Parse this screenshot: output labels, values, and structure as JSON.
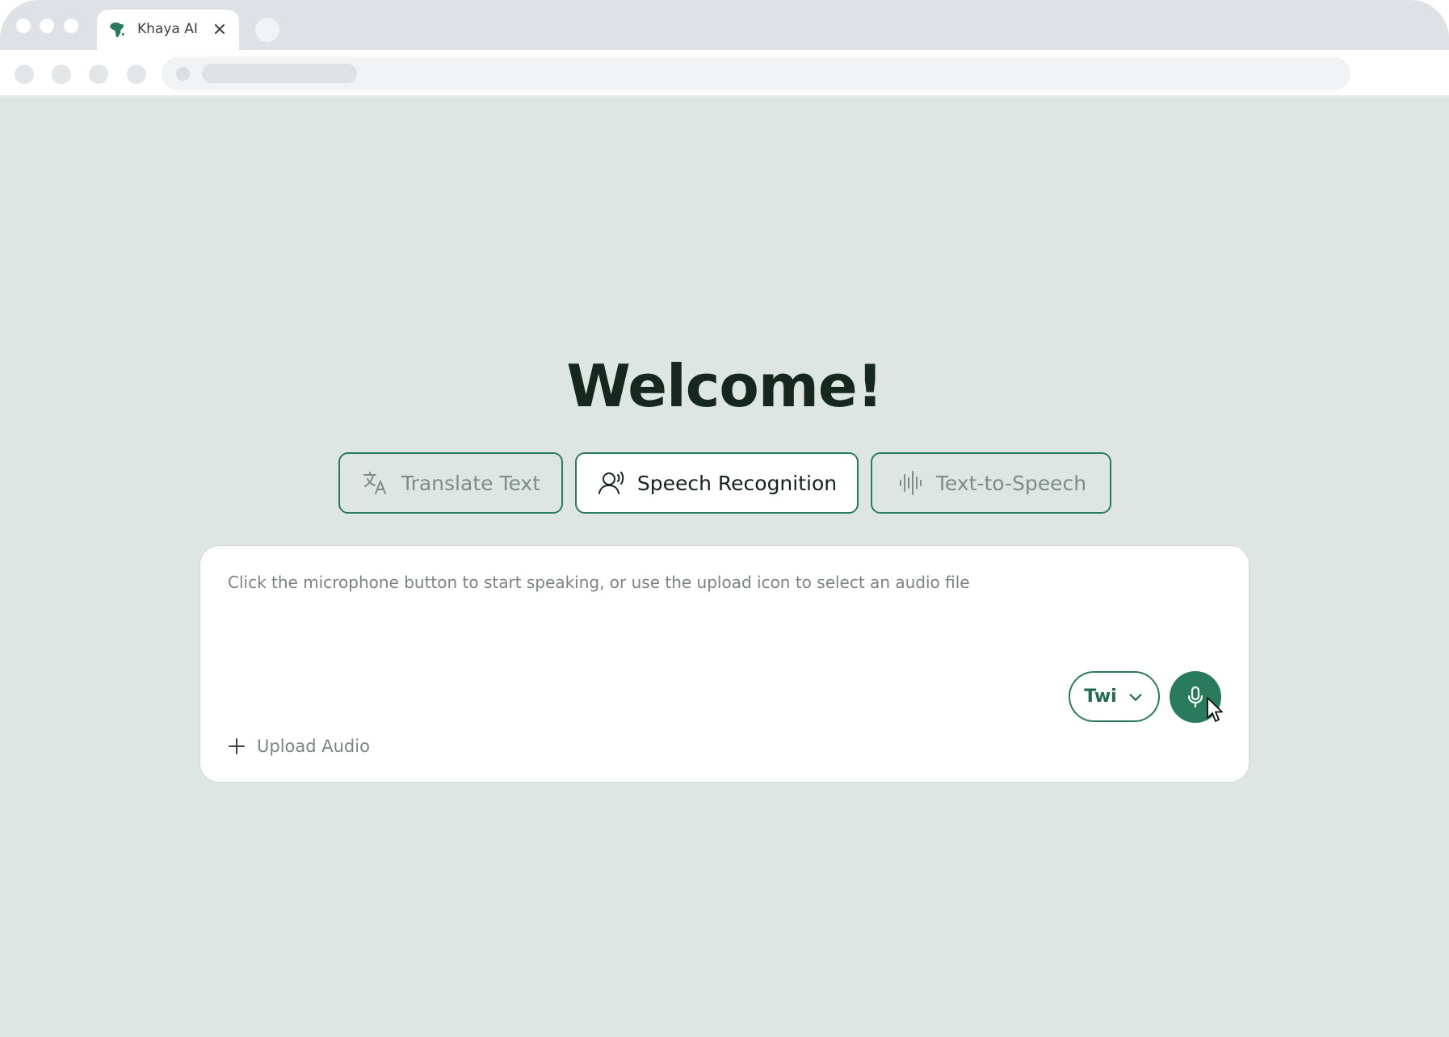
{
  "browser": {
    "tab_title": "Khaya AI",
    "icons": {
      "favicon": "africa-map-icon",
      "close": "close-icon"
    }
  },
  "page": {
    "heading": "Welcome!",
    "modes": [
      {
        "label": "Translate Text",
        "icon": "translate-icon",
        "active": false
      },
      {
        "label": "Speech Recognition",
        "icon": "speech-recognition-icon",
        "active": true
      },
      {
        "label": "Text-to-Speech",
        "icon": "audio-waveform-icon",
        "active": false
      }
    ],
    "input_prompt": "Click the microphone button to start speaking, or use the upload icon to select an audio file",
    "language": {
      "selected": "Twi",
      "icon": "chevron-down-icon"
    },
    "mic_icon": "microphone-icon",
    "upload_label": "Upload Audio",
    "upload_icon": "plus-icon"
  },
  "colors": {
    "accent": "#2a7a5e",
    "page_background": "#dde6e2",
    "heading": "#15271f",
    "muted_text": "#7c8480"
  }
}
